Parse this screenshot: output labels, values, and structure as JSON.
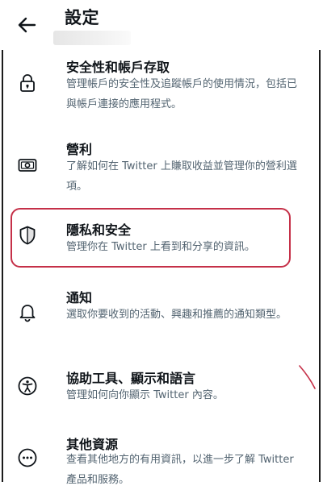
{
  "header": {
    "title": "設定"
  },
  "items": [
    {
      "icon": "lock-icon",
      "title": "安全性和帳戶存取",
      "description": "管理帳戶的安全性及追蹤帳戶的使用情況，包括已與帳戶連接的應用程式。"
    },
    {
      "icon": "money-icon",
      "title": "營利",
      "description": "了解如何在 Twitter 上賺取收益並管理你的營利選項。"
    },
    {
      "icon": "shield-icon",
      "title": "隱私和安全",
      "description": "管理你在 Twitter 上看到和分享的資訊。"
    },
    {
      "icon": "bell-icon",
      "title": "通知",
      "description": "選取你要收到的活動、興趣和推薦的通知類型。"
    },
    {
      "icon": "accessibility-icon",
      "title": "協助工具、顯示和語言",
      "description": "管理如何向你顯示 Twitter 內容。"
    },
    {
      "icon": "more-icon",
      "title": "其他資源",
      "description": "查看其他地方的有用資訊，以進一步了解 Twitter 產品和服務。"
    }
  ],
  "colors": {
    "highlight": "#c53048",
    "text_primary": "#0f1419",
    "text_secondary": "#536471"
  }
}
